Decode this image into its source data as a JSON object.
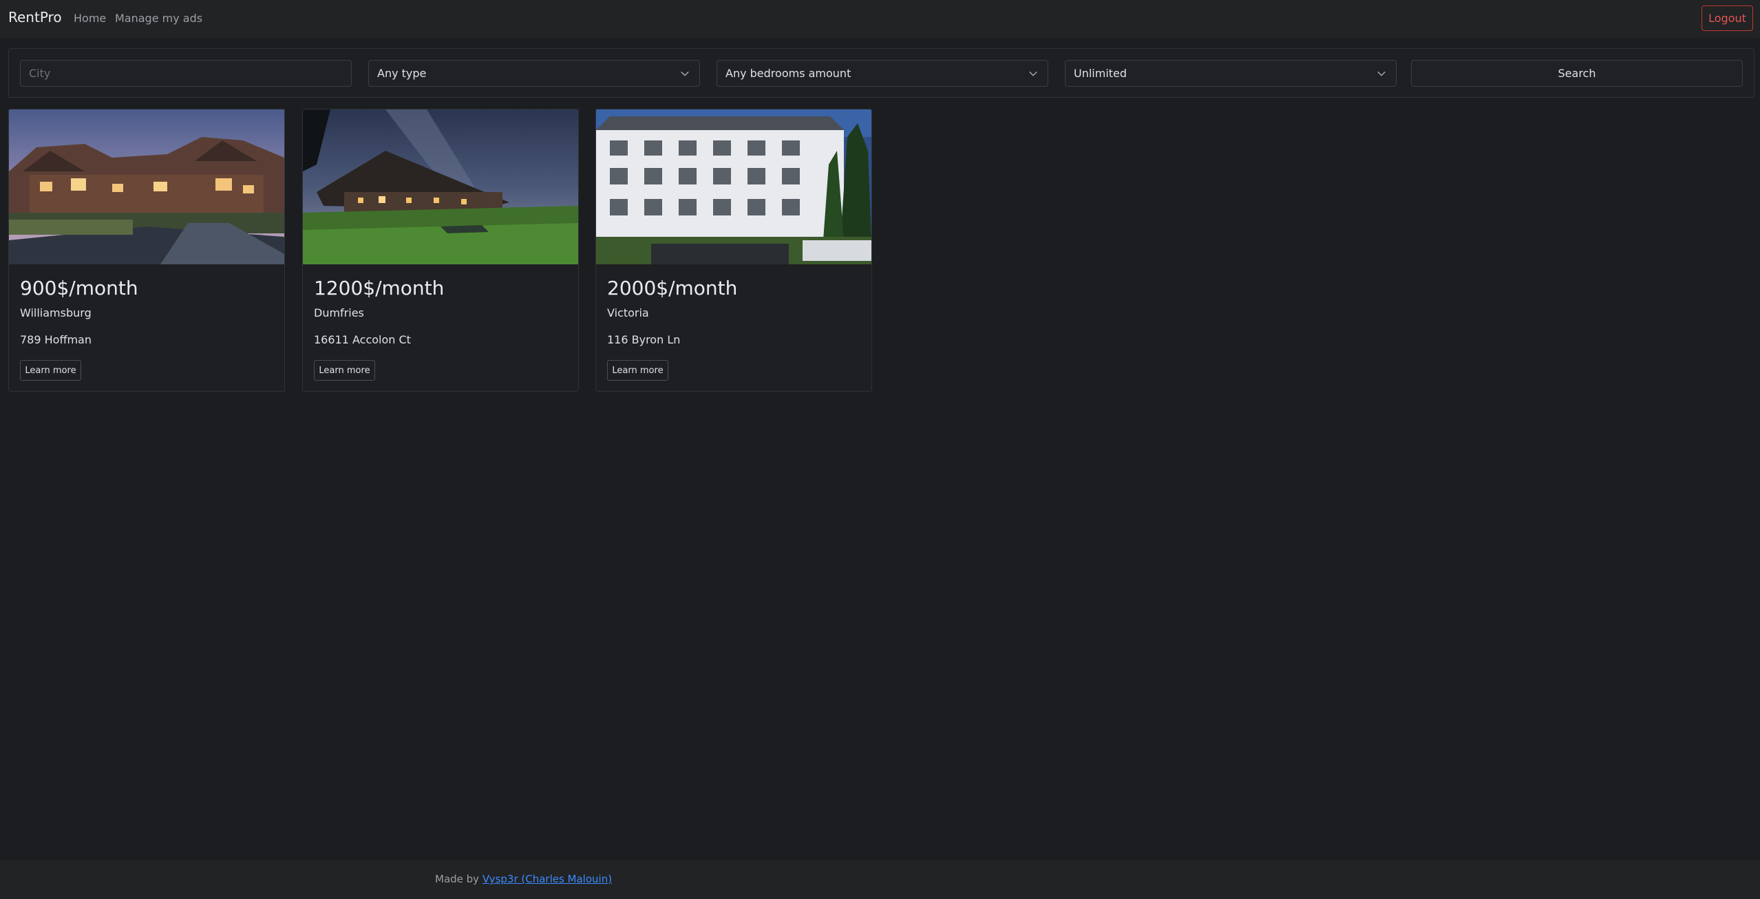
{
  "navbar": {
    "brand": "RentPro",
    "links": [
      "Home",
      "Manage my ads"
    ],
    "logout_label": "Logout",
    "logout_color": "#dc3545"
  },
  "filters": {
    "city_placeholder": "City",
    "type_value": "Any type",
    "bedrooms_value": "Any bedrooms amount",
    "price_value": "Unlimited",
    "search_label": "Search"
  },
  "listings": [
    {
      "price": "900$/month",
      "city": "Williamsburg",
      "address": "789 Hoffman",
      "button": "Learn more"
    },
    {
      "price": "1200$/month",
      "city": "Dumfries",
      "address": "16611 Accolon Ct",
      "button": "Learn more"
    },
    {
      "price": "2000$/month",
      "city": "Victoria",
      "address": "116 Byron Ln",
      "button": "Learn more"
    }
  ],
  "footer": {
    "prefix": "Made by ",
    "author": "Vysp3r (Charles Malouin)",
    "link_color": "#3d8bfd"
  }
}
